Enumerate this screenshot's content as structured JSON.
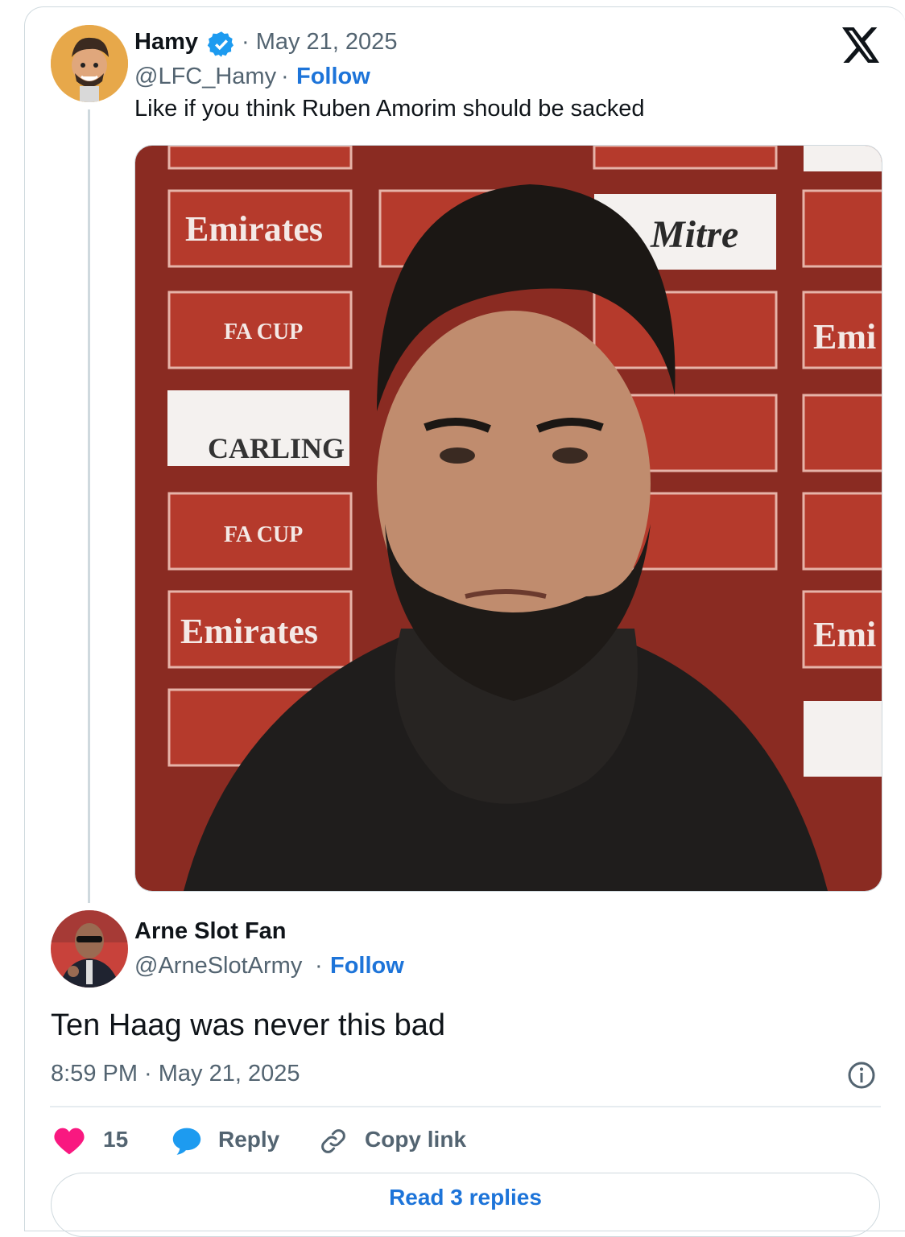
{
  "tweet": {
    "author_name": "Hamy",
    "date": "· May 21, 2025",
    "handle": "@LFC_Hamy",
    "dot": "·",
    "follow": "Follow",
    "text": "Like if you think Ruben Amorim should be sacked",
    "media_texts": [
      "Emirates",
      "Emirates FA CUP",
      "CARLING",
      "Emirates FA CUP",
      "Emirates",
      "Mitre",
      "Emi",
      "Emi"
    ]
  },
  "reply": {
    "author_name": "Arne Slot Fan",
    "handle": "@ArneSlotArmy",
    "dot": "·",
    "follow": "Follow",
    "text": "Ten Haag was never this bad",
    "timestamp": "8:59 PM · May 21, 2025"
  },
  "actions": {
    "like_count": "15",
    "reply_label": "Reply",
    "copy_label": "Copy link",
    "read_replies": "Read 3 replies"
  },
  "colors": {
    "accent": "#1d74d9",
    "like": "#f91880",
    "verified": "#1d9bf0"
  },
  "icons": [
    "x-logo-icon",
    "verified-badge-icon",
    "heart-icon",
    "reply-bubble-icon",
    "link-icon",
    "info-icon"
  ]
}
